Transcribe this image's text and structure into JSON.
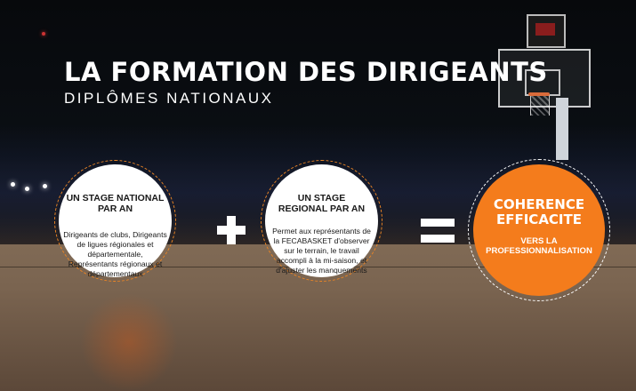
{
  "header": {
    "title": "LA FORMATION DES DIRIGEANTS",
    "subtitle": "DIPLÔMES NATIONAUX"
  },
  "stages": [
    {
      "heading": "UN STAGE NATIONAL PAR AN",
      "description": "Dirigeants de clubs, Dirigeants de ligues régionales et départementale, Représentants régionaux et départementaux"
    },
    {
      "heading": "UN STAGE REGIONAL PAR AN",
      "description": "Permet aux représentants de la FECABASKET d'observer sur le terrain, le travail accompli à la mi-saison, et d'ajuster les manquements"
    }
  ],
  "result": {
    "heading": "COHERENCE EFFICACITE",
    "caption": "VERS LA PROFESSIONNALISATION"
  },
  "colors": {
    "accent": "#f47c1c",
    "text_dark": "#1a1a1a",
    "text_light": "#ffffff"
  },
  "icons": {
    "operator_1": "plus-icon",
    "operator_2": "equals-icon"
  }
}
